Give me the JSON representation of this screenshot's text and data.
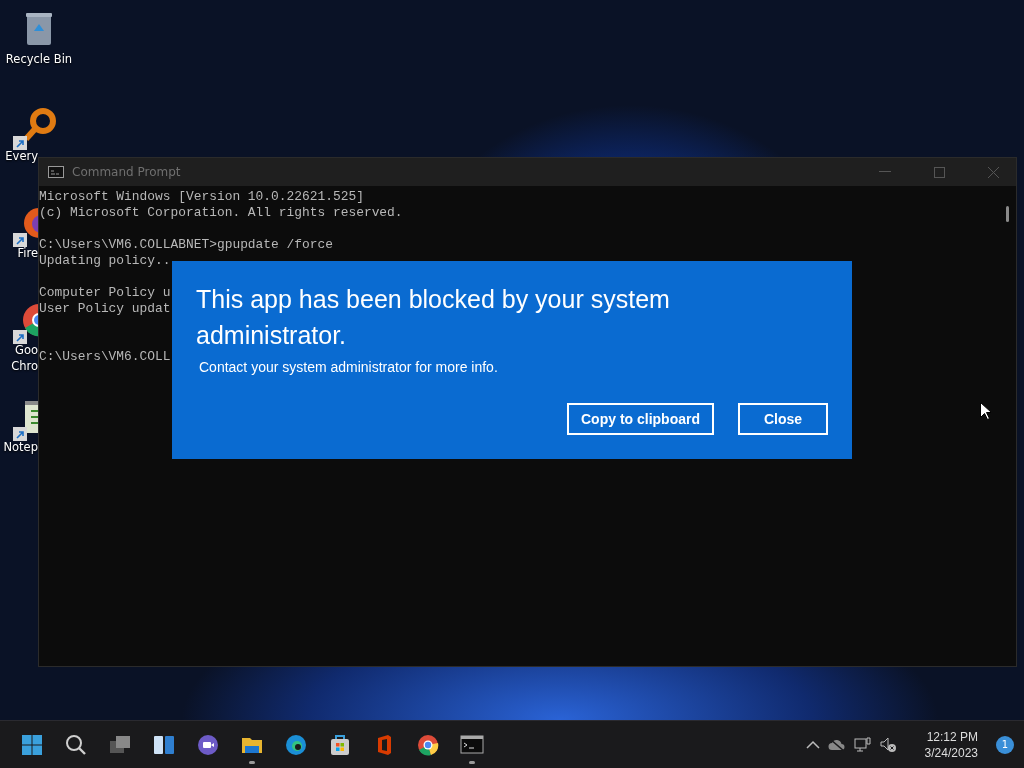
{
  "desktop_icons": [
    {
      "kind": "recycle",
      "label": "Recycle Bin",
      "shortcut": false,
      "clipped": false
    },
    {
      "kind": "search-ring",
      "label": "Every",
      "shortcut": true,
      "clipped": true
    },
    {
      "kind": "fox",
      "label": "Fire",
      "shortcut": true,
      "clipped": true
    },
    {
      "kind": "browser-ring",
      "label": "Goo Chro",
      "shortcut": true,
      "clipped": true
    },
    {
      "kind": "notepad",
      "label": "Notep",
      "shortcut": true,
      "clipped": true
    }
  ],
  "console_window": {
    "title": "Command Prompt",
    "blocks": [
      [
        "Microsoft Windows [Version 10.0.22621.525]",
        "(c) Microsoft Corporation. All rights reserved."
      ],
      [
        "C:\\Users\\VM6.COLLABNET>gpupdate /force",
        "Updating policy.."
      ],
      [
        "Computer Policy u",
        "User Policy updat"
      ]
    ],
    "prompt": "C:\\Users\\VM6.COLL"
  },
  "dialog": {
    "title": "This app has been blocked by your system administrator.",
    "message": "Contact your system administrator for more info.",
    "buttons": [
      "Copy to clipboard",
      "Close"
    ]
  },
  "taskbar": {
    "apps": [
      {
        "kind": "start",
        "running": false
      },
      {
        "kind": "search",
        "running": false
      },
      {
        "kind": "task-view",
        "running": false
      },
      {
        "kind": "widgets",
        "running": false
      },
      {
        "kind": "chat",
        "running": false
      },
      {
        "kind": "folder",
        "running": true
      },
      {
        "kind": "edge",
        "running": false
      },
      {
        "kind": "store",
        "running": false
      },
      {
        "kind": "office",
        "running": false
      },
      {
        "kind": "chrome",
        "running": false
      },
      {
        "kind": "terminal",
        "running": true
      }
    ],
    "clock": {
      "time": "12:12 PM",
      "date": "3/24/2023"
    },
    "notification_count": "1"
  }
}
